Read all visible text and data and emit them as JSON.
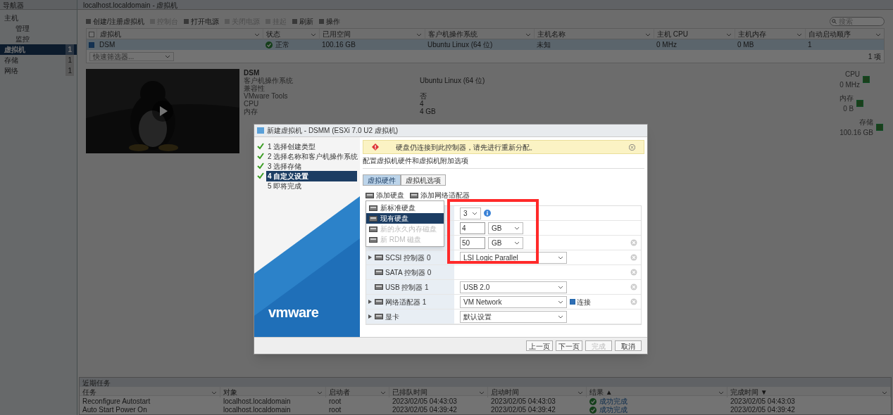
{
  "navigator": {
    "title": "导航器",
    "items": [
      {
        "label": "主机",
        "selected": false,
        "children": [
          {
            "label": "管理",
            "selected": false
          },
          {
            "label": "监控",
            "selected": false
          }
        ]
      },
      {
        "label": "虚拟机",
        "count": "1",
        "selected": true
      },
      {
        "label": "存储",
        "count": "1",
        "selected": false
      },
      {
        "label": "网络",
        "count": "1",
        "selected": false
      }
    ]
  },
  "header": {
    "title": "localhost.localdomain - 虚拟机"
  },
  "toolbar": [
    {
      "label": "创建/注册虚拟机",
      "disabled": false
    },
    {
      "label": "控制台",
      "disabled": true
    },
    {
      "label": "打开电源",
      "disabled": false
    },
    {
      "label": "关闭电源",
      "disabled": true
    },
    {
      "label": "挂起",
      "disabled": true
    },
    {
      "label": "刷新",
      "disabled": false
    },
    {
      "label": "操作",
      "disabled": false
    }
  ],
  "search": {
    "placeholder": "搜索"
  },
  "vm_table": {
    "all_checked": false,
    "columns": [
      "虚拟机",
      "状态",
      "已用空间",
      "客户机操作系统",
      "主机名称",
      "主机 CPU",
      "主机内存",
      "自动启动顺序"
    ],
    "rows": [
      {
        "checked": true,
        "selected": true,
        "cells": [
          "DSM",
          "正常",
          "100.16 GB",
          "Ubuntu Linux (64 位)",
          "未知",
          "0 MHz",
          "0 MB",
          "1"
        ]
      }
    ],
    "filter_placeholder": "快速筛选器...",
    "count": "1 项"
  },
  "details": {
    "name": "DSM",
    "properties": [
      {
        "label": "客户机操作系统",
        "value": "Ubuntu Linux (64 位)"
      },
      {
        "label": "兼容性"
      },
      {
        "label": "VMware Tools",
        "value": "否"
      },
      {
        "label": "CPU",
        "value": "4"
      },
      {
        "label": "内存",
        "value": "4 GB"
      }
    ],
    "resources": [
      {
        "label": "CPU",
        "value": "0 MHz"
      },
      {
        "label": "内存",
        "value": "0 B"
      },
      {
        "label": "存储",
        "value": "100.16 GB"
      }
    ]
  },
  "dialog": {
    "title": "新建虚拟机 - DSMM (ESXi 7.0 U2 虚拟机)",
    "steps": [
      {
        "label": "1 选择创建类型",
        "done": true,
        "selected": false
      },
      {
        "label": "2 选择名称和客户机操作系统",
        "done": true,
        "selected": false
      },
      {
        "label": "3 选择存储",
        "done": true,
        "selected": false
      },
      {
        "label": "4 自定义设置",
        "done": true,
        "selected": true
      },
      {
        "label": "5 即将完成",
        "done": false,
        "selected": false
      }
    ],
    "logo": "vmware",
    "warning": "硬盘仍连接到此控制器，请先进行重新分配。",
    "subtitle": "配置虚拟机硬件和虚拟机附加选项",
    "tabs": [
      {
        "label": "虚拟硬件",
        "selected": true
      },
      {
        "label": "虚拟机选项",
        "selected": false
      }
    ],
    "add_buttons": [
      "添加硬盘",
      "添加网络适配器"
    ],
    "add_menu": [
      {
        "label": "新标准硬盘",
        "selected": false,
        "disabled": false
      },
      {
        "label": "现有硬盘",
        "selected": true,
        "disabled": false
      },
      {
        "label": "新的永久内存磁盘",
        "selected": false,
        "disabled": true
      },
      {
        "label": "新 RDM 磁盘",
        "selected": false,
        "disabled": true
      }
    ],
    "hardware": [
      {
        "kind": "count",
        "value": "3",
        "info": true,
        "removable": false
      },
      {
        "kind": "size",
        "value": "4",
        "unit": "GB",
        "removable": false
      },
      {
        "kind": "size",
        "value": "50",
        "unit": "GB",
        "removable": true
      },
      {
        "kind": "select",
        "label": "SCSI 控制器 0",
        "expandable": true,
        "value": "LSI Logic Parallel",
        "removable": true
      },
      {
        "kind": "blank",
        "label": "SATA 控制器 0",
        "expandable": false,
        "removable": true
      },
      {
        "kind": "select",
        "label": "USB 控制器 1",
        "expandable": false,
        "value": "USB 2.0",
        "removable": true
      },
      {
        "kind": "network",
        "label": "网络适配器 1",
        "expandable": true,
        "value": "VM Network",
        "connect_label": "连接",
        "checked": true,
        "removable": true
      },
      {
        "kind": "select",
        "label": "显卡",
        "expandable": true,
        "value": "默认设置",
        "removable": false
      }
    ],
    "buttons": [
      {
        "label": "上一页",
        "disabled": false
      },
      {
        "label": "下一页",
        "disabled": false
      },
      {
        "label": "完成",
        "disabled": true
      },
      {
        "label": "取消",
        "disabled": false
      }
    ]
  },
  "tasks": {
    "title": "近期任务",
    "columns": [
      "任务",
      "对象",
      "启动者",
      "已排队时间",
      "启动时间",
      "结果 ▲",
      "完成时间 ▼"
    ],
    "rows": [
      [
        "Reconfigure Autostart",
        "localhost.localdomain",
        "root",
        "2023/02/05 04:43:03",
        "2023/02/05 04:43:03",
        "成功完成",
        "2023/02/05 04:43:03"
      ],
      [
        "Auto Start Power On",
        "localhost.localdomain",
        "root",
        "2023/02/05 04:39:42",
        "2023/02/05 04:39:42",
        "成功完成",
        "2023/02/05 04:39:42"
      ]
    ]
  }
}
